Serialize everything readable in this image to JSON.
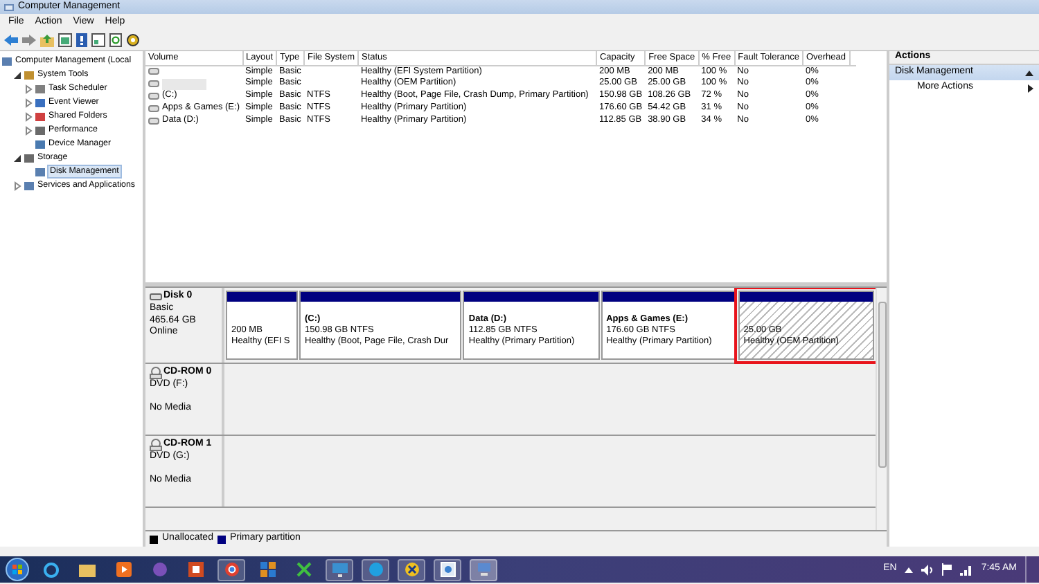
{
  "window": {
    "title": "Computer Management"
  },
  "menu": [
    {
      "label": "File"
    },
    {
      "label": "Action"
    },
    {
      "label": "View"
    },
    {
      "label": "Help"
    }
  ],
  "tree": [
    {
      "label": "Computer Management (Local",
      "selected": false,
      "children": [
        {
          "label": "System Tools",
          "expanded": true,
          "selected": false,
          "children": [
            {
              "label": "Task Scheduler",
              "expanded": false,
              "selected": false
            },
            {
              "label": "Event Viewer",
              "expanded": false,
              "selected": false
            },
            {
              "label": "Shared Folders",
              "expanded": false,
              "selected": false
            },
            {
              "label": "Performance",
              "expanded": false,
              "selected": false
            },
            {
              "label": "Device Manager",
              "selected": false
            }
          ]
        },
        {
          "label": "Storage",
          "expanded": true,
          "selected": false,
          "children": [
            {
              "label": "Disk Management",
              "selected": true
            }
          ]
        },
        {
          "label": "Services and Applications",
          "expanded": false,
          "selected": false
        }
      ]
    }
  ],
  "volumes": {
    "columns": [
      "Volume",
      "Layout",
      "Type",
      "File System",
      "Status",
      "Capacity",
      "Free Space",
      "% Free",
      "Fault Tolerance",
      "Overhead"
    ],
    "rows": [
      {
        "layout": "Simple",
        "type": "Basic",
        "status": "Healthy (EFI System Partition)",
        "capacity": "200 MB",
        "free_space": "200 MB",
        "percent_free": "100 %",
        "fault_tolerance": "No",
        "overhead": "0%",
        "blurred": false
      },
      {
        "layout": "Simple",
        "type": "Basic",
        "status": "Healthy (OEM Partition)",
        "capacity": "25.00 GB",
        "free_space": "25.00 GB",
        "percent_free": "100 %",
        "fault_tolerance": "No",
        "overhead": "0%",
        "blurred": true
      },
      {
        "volume": "(C:)",
        "layout": "Simple",
        "type": "Basic",
        "file_system": "NTFS",
        "status": "Healthy (Boot, Page File, Crash Dump, Primary Partition)",
        "capacity": "150.98 GB",
        "free_space": "108.26 GB",
        "percent_free": "72 %",
        "fault_tolerance": "No",
        "overhead": "0%",
        "blurred": false
      },
      {
        "volume": "Apps & Games (E:)",
        "layout": "Simple",
        "type": "Basic",
        "file_system": "NTFS",
        "status": "Healthy (Primary Partition)",
        "capacity": "176.60 GB",
        "free_space": "54.42 GB",
        "percent_free": "31 %",
        "fault_tolerance": "No",
        "overhead": "0%",
        "blurred": false
      },
      {
        "volume": "Data (D:)",
        "layout": "Simple",
        "type": "Basic",
        "file_system": "NTFS",
        "status": "Healthy (Primary Partition)",
        "capacity": "112.85 GB",
        "free_space": "38.90 GB",
        "percent_free": "34 %",
        "fault_tolerance": "No",
        "overhead": "0%",
        "blurred": false
      }
    ]
  },
  "disks": [
    {
      "kind": "disk",
      "name": "Disk 0",
      "lines": [
        "Basic",
        "465.64 GB",
        "Online"
      ],
      "partitions": [
        {
          "size": "200 MB",
          "status": "Healthy (EFI S",
          "selected": false,
          "highlighted": false
        },
        {
          "label": "(C:)",
          "size": "150.98 GB NTFS",
          "status": "Healthy (Boot, Page File, Crash Dur",
          "selected": false,
          "highlighted": false
        },
        {
          "label": "Data  (D:)",
          "size": "112.85 GB NTFS",
          "status": "Healthy (Primary Partition)",
          "selected": false,
          "highlighted": false
        },
        {
          "label": "Apps & Games  (E:)",
          "size": "176.60 GB NTFS",
          "status": "Healthy (Primary Partition)",
          "selected": false,
          "highlighted": false
        },
        {
          "size": "25.00 GB",
          "status": "Healthy (OEM Partition)",
          "selected": true,
          "highlighted": true
        }
      ]
    },
    {
      "kind": "cdrom",
      "name": "CD-ROM 0",
      "lines": [
        "DVD (F:)",
        "No Media"
      ]
    },
    {
      "kind": "cdrom",
      "name": "CD-ROM 1",
      "lines": [
        "DVD (G:)",
        "No Media"
      ]
    }
  ],
  "legend": [
    {
      "label": "Unallocated",
      "color": "#000000"
    },
    {
      "label": "Primary partition",
      "color": "#000080"
    }
  ],
  "actions": {
    "title": "Actions",
    "sections": [
      {
        "label": "Disk Management",
        "expanded": true,
        "items": [
          {
            "label": "More Actions"
          }
        ]
      }
    ]
  },
  "taskbar": {
    "language": "EN",
    "clock": "7:45 AM"
  }
}
